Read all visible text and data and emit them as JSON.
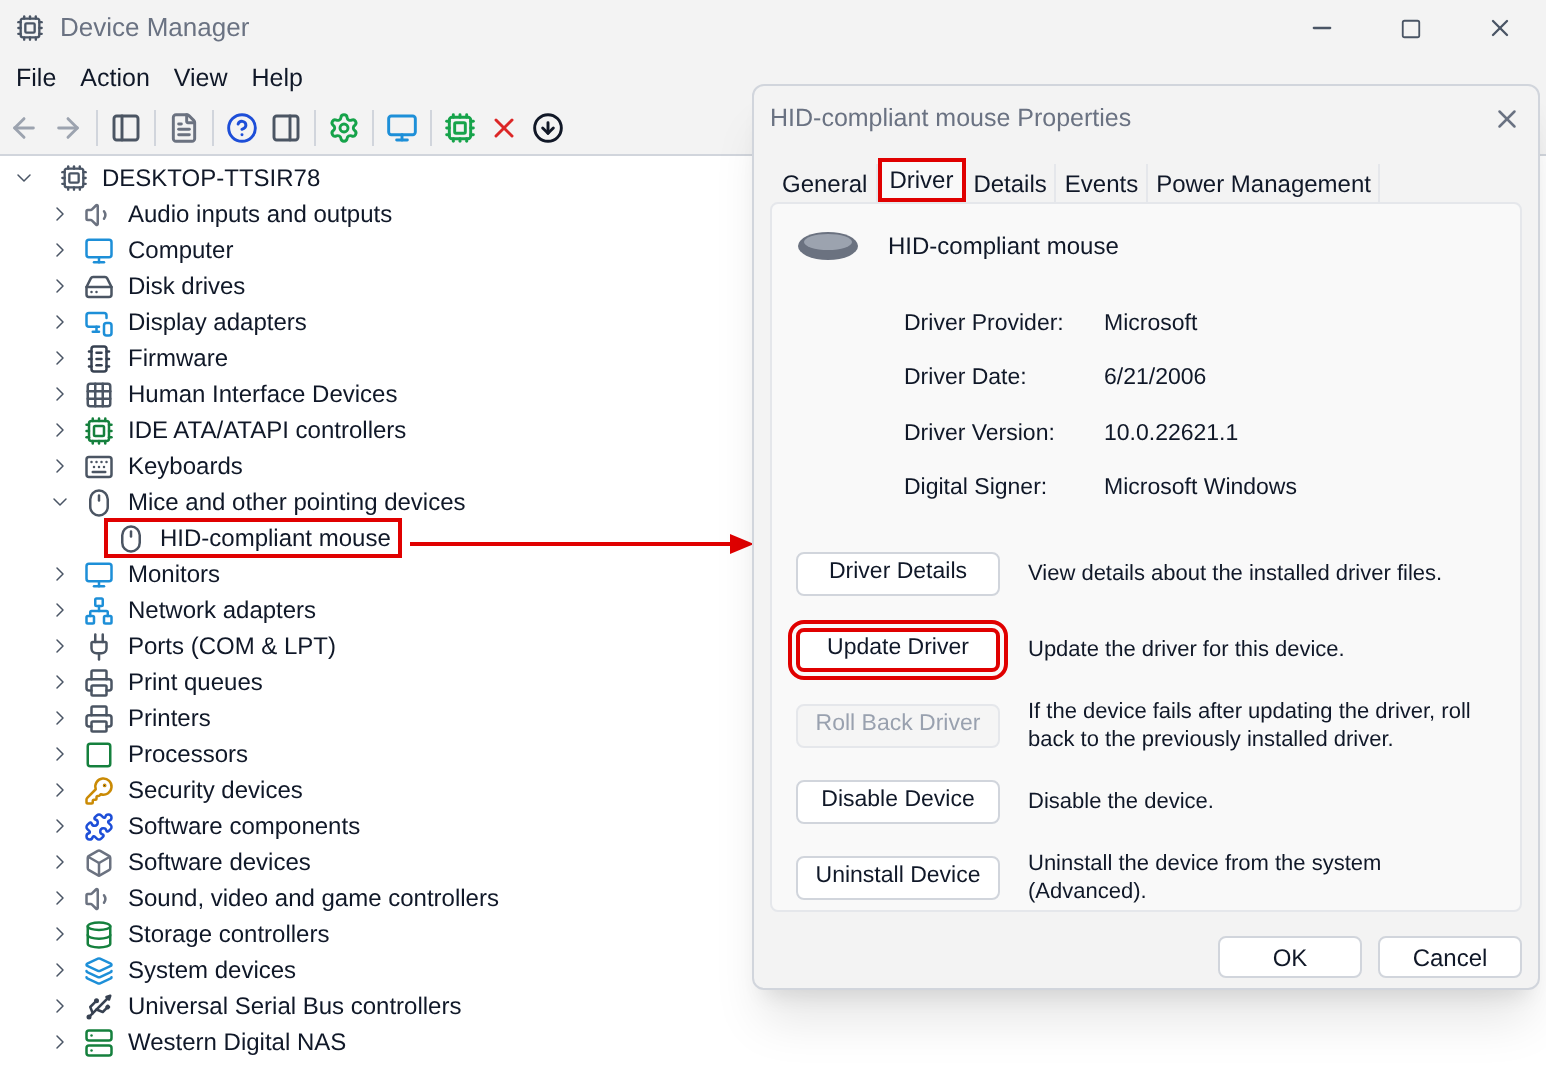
{
  "window": {
    "title": "Device Manager"
  },
  "menu": [
    "File",
    "Action",
    "View",
    "Help"
  ],
  "tree": {
    "label": "DESKTOP-TTSIR78",
    "expanded": true,
    "children": [
      {
        "label": "Audio inputs and outputs",
        "expanded": false
      },
      {
        "label": "Computer",
        "expanded": false
      },
      {
        "label": "Disk drives",
        "expanded": false
      },
      {
        "label": "Display adapters",
        "expanded": false
      },
      {
        "label": "Firmware",
        "expanded": false
      },
      {
        "label": "Human Interface Devices",
        "expanded": false
      },
      {
        "label": "IDE ATA/ATAPI controllers",
        "expanded": false
      },
      {
        "label": "Keyboards",
        "expanded": false
      },
      {
        "label": "Mice and other pointing devices",
        "expanded": true,
        "children": [
          {
            "label": "HID-compliant mouse",
            "highlighted": true
          }
        ]
      },
      {
        "label": "Monitors",
        "expanded": false
      },
      {
        "label": "Network adapters",
        "expanded": false
      },
      {
        "label": "Ports (COM & LPT)",
        "expanded": false
      },
      {
        "label": "Print queues",
        "expanded": false
      },
      {
        "label": "Printers",
        "expanded": false
      },
      {
        "label": "Processors",
        "expanded": false
      },
      {
        "label": "Security devices",
        "expanded": false
      },
      {
        "label": "Software components",
        "expanded": false
      },
      {
        "label": "Software devices",
        "expanded": false
      },
      {
        "label": "Sound, video and game controllers",
        "expanded": false
      },
      {
        "label": "Storage controllers",
        "expanded": false
      },
      {
        "label": "System devices",
        "expanded": false
      },
      {
        "label": "Universal Serial Bus controllers",
        "expanded": false
      },
      {
        "label": "Western Digital NAS",
        "expanded": false
      }
    ]
  },
  "dialog": {
    "title": "HID-compliant mouse Properties",
    "tabs": [
      {
        "label": "General",
        "selected": false,
        "highlighted": false
      },
      {
        "label": "Driver",
        "selected": true,
        "highlighted": true
      },
      {
        "label": "Details",
        "selected": false,
        "highlighted": false
      },
      {
        "label": "Events",
        "selected": false,
        "highlighted": false
      },
      {
        "label": "Power Management",
        "selected": false,
        "highlighted": false
      }
    ],
    "device_name": "HID-compliant mouse",
    "properties": [
      {
        "label": "Driver Provider:",
        "value": "Microsoft"
      },
      {
        "label": "Driver Date:",
        "value": "6/21/2006"
      },
      {
        "label": "Driver Version:",
        "value": "10.0.22621.1"
      },
      {
        "label": "Digital Signer:",
        "value": "Microsoft Windows"
      }
    ],
    "actions": [
      {
        "button": "Driver Details",
        "description": "View details about the installed driver files.",
        "disabled": false,
        "highlighted": false
      },
      {
        "button": "Update Driver",
        "description": "Update the driver for this device.",
        "disabled": false,
        "highlighted": true
      },
      {
        "button": "Roll Back Driver",
        "description": "If the device fails after updating the driver, roll back to the previously installed driver.",
        "disabled": true,
        "highlighted": false
      },
      {
        "button": "Disable Device",
        "description": "Disable the device.",
        "disabled": false,
        "highlighted": false
      },
      {
        "button": "Uninstall Device",
        "description": "Uninstall the device from the system (Advanced).",
        "disabled": false,
        "highlighted": false
      }
    ],
    "buttons": [
      "OK",
      "Cancel"
    ]
  }
}
